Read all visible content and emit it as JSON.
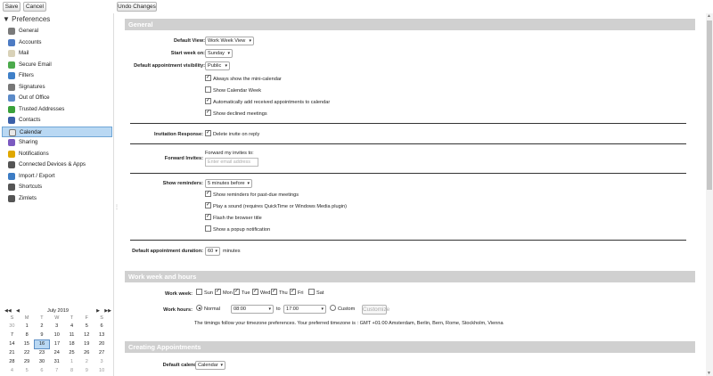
{
  "toolbar": {
    "save": "Save",
    "cancel": "Cancel",
    "undo": "Undo Changes"
  },
  "sidebar": {
    "title": "Preferences",
    "items": [
      {
        "label": "General",
        "icon": "gear-icon",
        "color": "#7a7a7a"
      },
      {
        "label": "Accounts",
        "icon": "accounts-icon",
        "color": "#4d7bc3"
      },
      {
        "label": "Mail",
        "icon": "mail-icon",
        "color": "#d9d2b8"
      },
      {
        "label": "Secure Email",
        "icon": "secure-email-icon",
        "color": "#4caa4c"
      },
      {
        "label": "Filters",
        "icon": "filters-icon",
        "color": "#3f80c8"
      },
      {
        "label": "Signatures",
        "icon": "signatures-icon",
        "color": "#777777"
      },
      {
        "label": "Out of Office",
        "icon": "out-of-office-icon",
        "color": "#5b8ac8"
      },
      {
        "label": "Trusted Addresses",
        "icon": "shield-icon",
        "color": "#3aa13a"
      },
      {
        "label": "Contacts",
        "icon": "contacts-icon",
        "color": "#3a5fa8"
      },
      {
        "label": "Calendar",
        "icon": "calendar-icon",
        "color": "#e8e8e8"
      },
      {
        "label": "Sharing",
        "icon": "sharing-icon",
        "color": "#7b5ac0"
      },
      {
        "label": "Notifications",
        "icon": "bell-icon",
        "color": "#e0a800"
      },
      {
        "label": "Connected Devices & Apps",
        "icon": "devices-icon",
        "color": "#555555"
      },
      {
        "label": "Import / Export",
        "icon": "import-export-icon",
        "color": "#3c7cc4"
      },
      {
        "label": "Shortcuts",
        "icon": "shortcuts-icon",
        "color": "#555555"
      },
      {
        "label": "Zimlets",
        "icon": "zimlets-icon",
        "color": "#555555"
      }
    ]
  },
  "mini_calendar": {
    "month": "July 2019",
    "days": [
      "S",
      "M",
      "T",
      "W",
      "T",
      "F",
      "S"
    ],
    "weeks": [
      [
        "30",
        "1",
        "2",
        "3",
        "4",
        "5",
        "6"
      ],
      [
        "7",
        "8",
        "9",
        "10",
        "11",
        "12",
        "13"
      ],
      [
        "14",
        "15",
        "16",
        "17",
        "18",
        "19",
        "20"
      ],
      [
        "21",
        "22",
        "23",
        "24",
        "25",
        "26",
        "27"
      ],
      [
        "28",
        "29",
        "30",
        "31",
        "1",
        "2",
        "3"
      ],
      [
        "4",
        "5",
        "6",
        "7",
        "8",
        "9",
        "10"
      ]
    ]
  },
  "general": {
    "title": "General",
    "default_view_label": "Default View:",
    "default_view": "Work Week View",
    "start_week_label": "Start week on:",
    "start_week": "Sunday",
    "visibility_label": "Default appointment visibility:",
    "visibility": "Public",
    "cb_mini": "Always show the mini-calendar",
    "cb_week": "Show Calendar Week",
    "cb_auto": "Automatically add received appointments to calendar",
    "cb_declined": "Show declined meetings",
    "invite_label": "Invitation Response:",
    "invite_cb": "Delete invite on reply",
    "forward_label": "Forward Invites:",
    "forward_text": "Forward my invites to:",
    "forward_placeholder": "Enter email address",
    "reminders_label": "Show reminders:",
    "reminders": "5 minutes before",
    "r1": "Show reminders for past-due meetings",
    "r2": "Play a sound (requires QuickTime or Windows Media plugin)",
    "r3": "Flash the browser title",
    "r4": "Show a popup notification",
    "duration_label": "Default appointment duration:",
    "duration": "60",
    "duration_unit": "minutes"
  },
  "work": {
    "title": "Work week and hours",
    "week_label": "Work week:",
    "days": [
      "Sun",
      "Mon",
      "Tue",
      "Wed",
      "Thu",
      "Fri",
      "Sat"
    ],
    "hours_label": "Work hours:",
    "normal": "Normal",
    "start": "08:00",
    "to": "to",
    "end": "17:00",
    "custom": "Custom",
    "customize": "Customize",
    "tz_note": "The timings follow your timezone preferences. Your preferred timezone is : GMT +01:00 Amsterdam, Berlin, Bern, Rome, Stockholm, Vienna"
  },
  "creating": {
    "title": "Creating Appointments",
    "default_cal_label": "Default calendar:",
    "default_cal": "Calendar"
  }
}
